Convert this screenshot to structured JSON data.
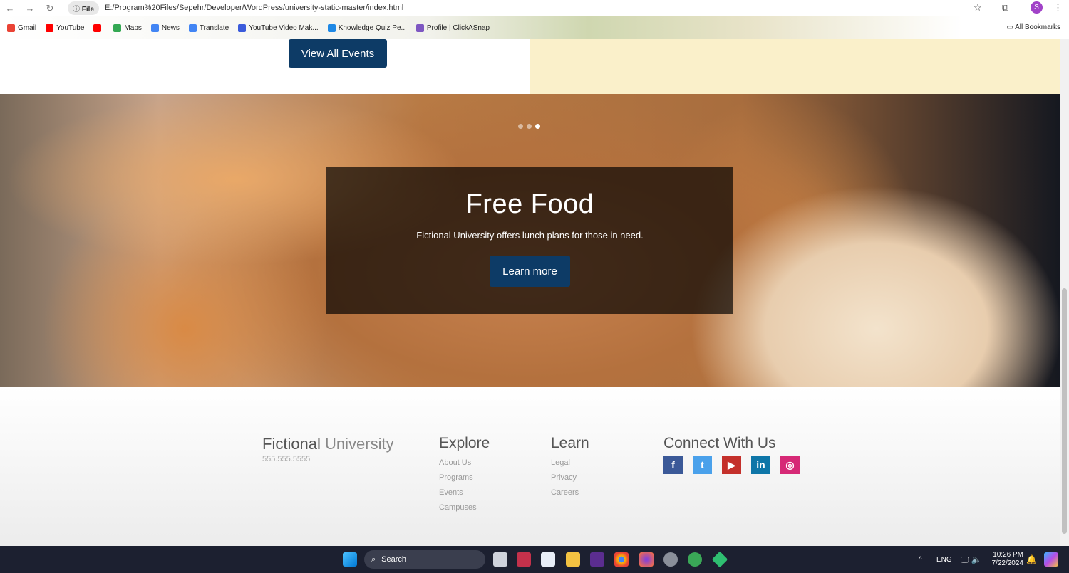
{
  "browser": {
    "chip": "File",
    "url": "E:/Program%20Files/Sepehr/Developer/WordPress/university-static-master/index.html",
    "bookmarks": [
      {
        "label": "Gmail",
        "color": "#ea4335"
      },
      {
        "label": "YouTube",
        "color": "#ff0000"
      },
      {
        "label": "",
        "color": "#ff0000"
      },
      {
        "label": "Maps",
        "color": "#34a853"
      },
      {
        "label": "News",
        "color": "#4285f4"
      },
      {
        "label": "Translate",
        "color": "#4285f4"
      },
      {
        "label": "YouTube Video Mak...",
        "color": "#3b5bdb"
      },
      {
        "label": "Knowledge Quiz Pe...",
        "color": "#1e88e5"
      },
      {
        "label": "Profile | ClickASnap",
        "color": "#7e57c2"
      }
    ],
    "all_bookmarks": "All Bookmarks",
    "profile_initial": "S"
  },
  "events": {
    "view_all": "View All Events"
  },
  "hero": {
    "title": "Free Food",
    "subtitle": "Fictional University offers lunch plans for those in need.",
    "cta": "Learn more",
    "slides": 3,
    "active_slide": 3
  },
  "footer": {
    "brand_bold": "Fictional",
    "brand_light": "University",
    "phone": "555.555.5555",
    "explore": {
      "title": "Explore",
      "links": [
        "About Us",
        "Programs",
        "Events",
        "Campuses"
      ]
    },
    "learn": {
      "title": "Learn",
      "links": [
        "Legal",
        "Privacy",
        "Careers"
      ]
    },
    "connect": {
      "title": "Connect With Us",
      "social": [
        {
          "name": "facebook",
          "glyph": "f",
          "color": "#3b5998"
        },
        {
          "name": "twitter",
          "glyph": "t",
          "color": "#4aa1eb"
        },
        {
          "name": "youtube",
          "glyph": "▶",
          "color": "#c4302b"
        },
        {
          "name": "linkedin",
          "glyph": "in",
          "color": "#0e76a8"
        },
        {
          "name": "instagram",
          "glyph": "◎",
          "color": "#d62976"
        }
      ]
    }
  },
  "taskbar": {
    "search": "Search",
    "lang": "ENG",
    "time": "10:26 PM",
    "date": "7/22/2024"
  }
}
